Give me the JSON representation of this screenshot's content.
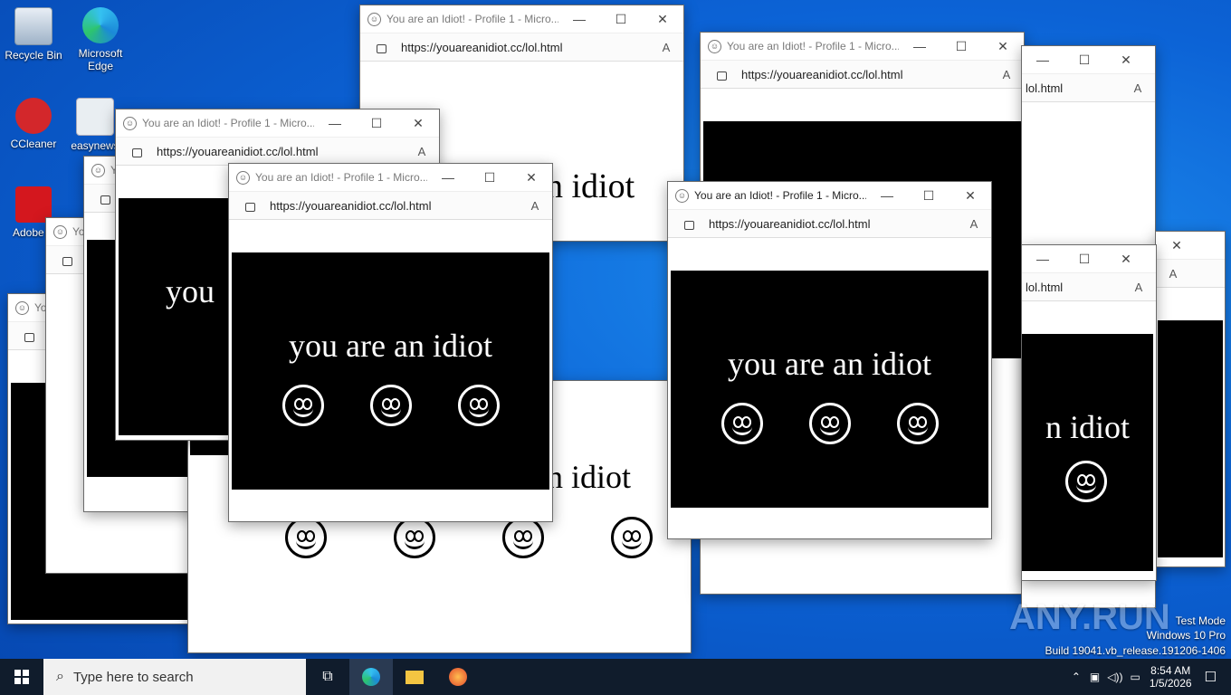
{
  "desktop": {
    "icons": [
      {
        "label": "Recycle Bin"
      },
      {
        "label": "Microsoft Edge"
      },
      {
        "label": "CCleaner"
      },
      {
        "label": "easynews"
      },
      {
        "label": "Adobe Acrobat"
      }
    ]
  },
  "popup": {
    "title": "You are an Idiot! - Profile 1 - Micro...",
    "title_short": "You are an Idiot! - Profile 1 - Micro...",
    "url": "https://youareanidiot.cc/lol.html",
    "url_tail": "lol.html",
    "message": "you are an idiot",
    "message_partial_1": "n idiot",
    "message_partial_2": "you",
    "message_partial_3": "ot"
  },
  "taskbar": {
    "search_placeholder": "Type here to search",
    "time": "8:54 AM",
    "date": "1/5/2026"
  },
  "watermark": {
    "line1": "Test Mode",
    "line2": "Windows 10 Pro",
    "line3": "Build 19041.vb_release.191206-1406",
    "brand": "ANY.RUN"
  },
  "colors": {
    "desktop": "#0c63d6",
    "taskbar": "#101c2c"
  }
}
